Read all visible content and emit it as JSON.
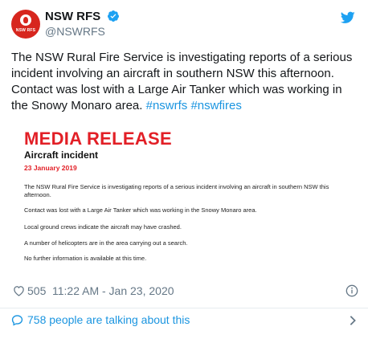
{
  "account": {
    "display_name": "NSW RFS",
    "handle": "@NSWRFS",
    "avatar_text": "NSW RFS"
  },
  "tweet": {
    "text": "The NSW Rural Fire Service is investigating reports of a serious incident involving an aircraft in southern NSW this afternoon. Contact was lost with a Large Air Tanker which was working in the Snowy Monaro area.",
    "hashtags": [
      "#nswrfs",
      "#nswfires"
    ]
  },
  "media_release": {
    "title": "MEDIA RELEASE",
    "heading": "Aircraft incident",
    "date": "23 January 2019",
    "paragraphs": [
      "The NSW Rural Fire Service is investigating reports of a serious incident involving an aircraft in southern NSW this afternoon.",
      "Contact was lost with a Large Air Tanker which was working in the Snowy Monaro area.",
      "Local ground crews indicate the aircraft may have crashed.",
      "A number of helicopters are in the area carrying out a search.",
      "No further information is available at this time."
    ]
  },
  "meta": {
    "likes": "505",
    "timestamp": "11:22 AM - Jan 23, 2020"
  },
  "conversation": {
    "label": "758 people are talking about this"
  },
  "colors": {
    "brand_red": "#d7261e",
    "link_blue": "#1b95e0",
    "muted": "#657786"
  },
  "icons": [
    "verified-badge-icon",
    "twitter-bird-icon",
    "heart-icon",
    "info-icon",
    "comment-icon",
    "chevron-right-icon"
  ]
}
